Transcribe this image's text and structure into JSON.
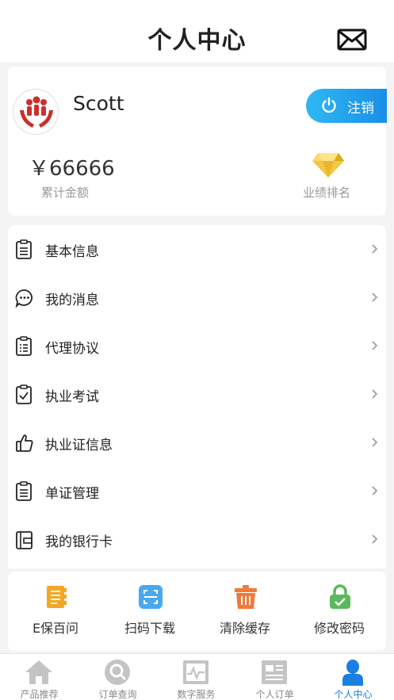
{
  "header": {
    "title": "个人中心",
    "mail_icon": "mail-icon"
  },
  "profile": {
    "username": "Scott",
    "logout_label": "注销",
    "amount": "￥66666",
    "amount_label": "累计金额",
    "rank_label": "业绩排名",
    "accent": "#1a8ee8"
  },
  "menu": {
    "items": [
      {
        "label": "基本信息",
        "icon": "clipboard-icon"
      },
      {
        "label": "我的消息",
        "icon": "message-bubble-icon"
      },
      {
        "label": "代理协议",
        "icon": "document-list-icon"
      },
      {
        "label": "执业考试",
        "icon": "exam-check-icon"
      },
      {
        "label": "执业证信息",
        "icon": "thumbs-up-icon"
      },
      {
        "label": "单证管理",
        "icon": "clipboard-icon"
      },
      {
        "label": "我的银行卡",
        "icon": "wallet-icon"
      }
    ]
  },
  "tools": {
    "items": [
      {
        "label": "E保百问",
        "icon": "notebook-icon",
        "color": "#f5a623"
      },
      {
        "label": "扫码下载",
        "icon": "scan-icon",
        "color": "#4aa8f0"
      },
      {
        "label": "清除缓存",
        "icon": "trash-icon",
        "color": "#f07a3a"
      },
      {
        "label": "修改密码",
        "icon": "lock-icon",
        "color": "#5cb85c"
      }
    ]
  },
  "tabbar": {
    "items": [
      {
        "label": "产品推荐",
        "icon": "home-icon"
      },
      {
        "label": "订单查询",
        "icon": "search-icon"
      },
      {
        "label": "数字服务",
        "icon": "chart-icon"
      },
      {
        "label": "个人订单",
        "icon": "order-list-icon"
      },
      {
        "label": "个人中心",
        "icon": "person-icon",
        "active": true
      }
    ],
    "active_color": "#1a7fe0"
  }
}
